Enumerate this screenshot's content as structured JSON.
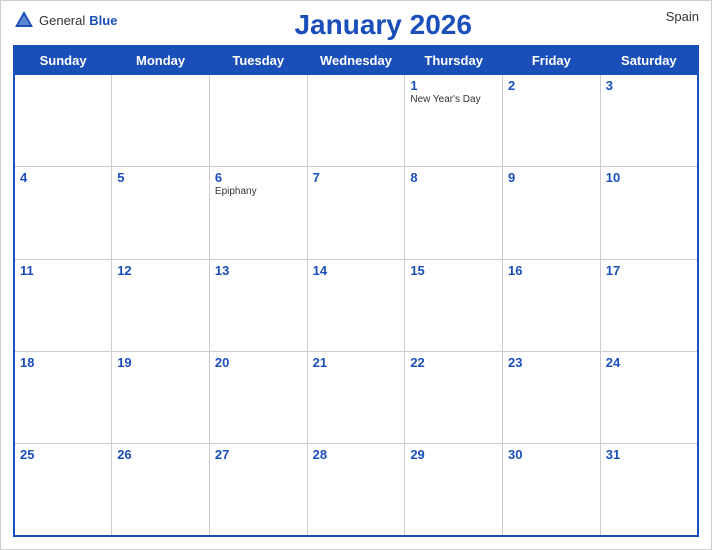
{
  "header": {
    "logo_general": "General",
    "logo_blue": "Blue",
    "title": "January 2026",
    "country": "Spain"
  },
  "weekdays": [
    "Sunday",
    "Monday",
    "Tuesday",
    "Wednesday",
    "Thursday",
    "Friday",
    "Saturday"
  ],
  "weeks": [
    [
      {
        "day": "",
        "holiday": ""
      },
      {
        "day": "",
        "holiday": ""
      },
      {
        "day": "",
        "holiday": ""
      },
      {
        "day": "",
        "holiday": ""
      },
      {
        "day": "1",
        "holiday": "New Year's Day"
      },
      {
        "day": "2",
        "holiday": ""
      },
      {
        "day": "3",
        "holiday": ""
      }
    ],
    [
      {
        "day": "4",
        "holiday": ""
      },
      {
        "day": "5",
        "holiday": ""
      },
      {
        "day": "6",
        "holiday": "Epiphany"
      },
      {
        "day": "7",
        "holiday": ""
      },
      {
        "day": "8",
        "holiday": ""
      },
      {
        "day": "9",
        "holiday": ""
      },
      {
        "day": "10",
        "holiday": ""
      }
    ],
    [
      {
        "day": "11",
        "holiday": ""
      },
      {
        "day": "12",
        "holiday": ""
      },
      {
        "day": "13",
        "holiday": ""
      },
      {
        "day": "14",
        "holiday": ""
      },
      {
        "day": "15",
        "holiday": ""
      },
      {
        "day": "16",
        "holiday": ""
      },
      {
        "day": "17",
        "holiday": ""
      }
    ],
    [
      {
        "day": "18",
        "holiday": ""
      },
      {
        "day": "19",
        "holiday": ""
      },
      {
        "day": "20",
        "holiday": ""
      },
      {
        "day": "21",
        "holiday": ""
      },
      {
        "day": "22",
        "holiday": ""
      },
      {
        "day": "23",
        "holiday": ""
      },
      {
        "day": "24",
        "holiday": ""
      }
    ],
    [
      {
        "day": "25",
        "holiday": ""
      },
      {
        "day": "26",
        "holiday": ""
      },
      {
        "day": "27",
        "holiday": ""
      },
      {
        "day": "28",
        "holiday": ""
      },
      {
        "day": "29",
        "holiday": ""
      },
      {
        "day": "30",
        "holiday": ""
      },
      {
        "day": "31",
        "holiday": ""
      }
    ]
  ]
}
